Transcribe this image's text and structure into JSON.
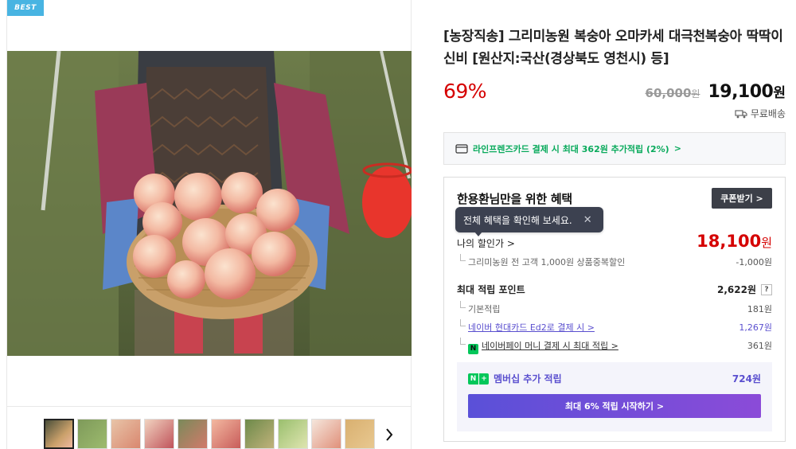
{
  "badge": "BEST",
  "product": {
    "title": "[농장직송] 그리미농원 복숭아 오마카세 대극천복숭아 딱딱이 신비 [원산지:국산(경상북도 영천시) 등]",
    "discount_rate": "69%",
    "original_price": "60,000",
    "original_unit": "원",
    "sale_price": "19,100",
    "sale_unit": "원",
    "shipping": "무료배송"
  },
  "card_banner": {
    "text": "라인프렌즈카드 결제 시 최대 362원 추가적립 (2%)",
    "arrow": ">"
  },
  "benefit": {
    "title": "한용환님만을 위한 혜택",
    "coupon_button": "쿠폰받기 >",
    "tooltip": "전체 혜택을 확인해 보세요.",
    "tooltip_close": "✕",
    "my_discount_label": "나의 할인가 >",
    "my_discount_value": "18,100",
    "my_discount_unit": "원",
    "farm_discount_label": "그리미농원 전 고객 1,000원 상품중복할인",
    "farm_discount_value": "-1,000원",
    "max_points_label": "최대 적립 포인트",
    "max_points_value": "2,622원",
    "help": "?",
    "basic_label": "기본적립",
    "basic_value": "181원",
    "hyundai_label": "네이버 현대카드 Ed2로 결제 시 >",
    "hyundai_value": "1,267원",
    "npay_icon": "N",
    "npay_label": "네이버페이 머니 결제 시 최대 적립 >",
    "npay_value": "361원"
  },
  "membership": {
    "badge_n": "N",
    "badge_plus": "+",
    "label": "멤버십 추가 적립",
    "value": "724원",
    "cta": "최대 6% 적립 시작하기 >"
  },
  "thumbnail_next": "›",
  "colors": {
    "discount_red": "#d50000",
    "naver_green": "#03c75a",
    "membership_purple": "#5a4fcf",
    "best_badge": "#48b4e2"
  }
}
